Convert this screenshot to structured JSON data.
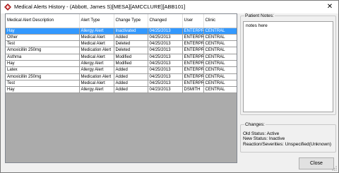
{
  "window": {
    "title": "Medical Alerts History - (Abbott, James S)[MESA][AMCCLURE][ABB101]",
    "accent_color": "#3399ff"
  },
  "grid": {
    "columns": [
      "Medical Alert Description",
      "Alert Type",
      "Change Type",
      "Changed",
      "User",
      "Clinic"
    ],
    "rows": [
      {
        "description": "Hay",
        "alert_type": "Allergy Alert",
        "change_type": "Inactivated",
        "changed": "04/25/2013",
        "user": "ENTERPRI",
        "clinic": "CENTRAL",
        "selected": true
      },
      {
        "description": "Other",
        "alert_type": "Medical Alert",
        "change_type": "Added",
        "changed": "04/25/2013",
        "user": "ENTERPRI",
        "clinic": "CENTRAL",
        "selected": false
      },
      {
        "description": "Test",
        "alert_type": "Medical Alert",
        "change_type": "Deleted",
        "changed": "04/25/2013",
        "user": "ENTERPRI",
        "clinic": "CENTRAL",
        "selected": false
      },
      {
        "description": "Amoxicillin 250mg",
        "alert_type": "Medication Alert",
        "change_type": "Deleted",
        "changed": "04/25/2013",
        "user": "ENTERPRI",
        "clinic": "CENTRAL",
        "selected": false
      },
      {
        "description": "Asthma",
        "alert_type": "Medical Alert",
        "change_type": "Modified",
        "changed": "04/25/2013",
        "user": "ENTERPRI",
        "clinic": "CENTRAL",
        "selected": false
      },
      {
        "description": "Hay",
        "alert_type": "Allergy Alert",
        "change_type": "Modified",
        "changed": "04/25/2013",
        "user": "ENTERPRI",
        "clinic": "CENTRAL",
        "selected": false
      },
      {
        "description": "Latex",
        "alert_type": "Allergy Alert",
        "change_type": "Added",
        "changed": "04/25/2013",
        "user": "ENTERPRI",
        "clinic": "CENTRAL",
        "selected": false
      },
      {
        "description": "Amoxicillin 250mg",
        "alert_type": "Medication Alert",
        "change_type": "Added",
        "changed": "04/25/2013",
        "user": "ENTERPRI",
        "clinic": "CENTRAL",
        "selected": false
      },
      {
        "description": "Test",
        "alert_type": "Medical Alert",
        "change_type": "Added",
        "changed": "04/25/2013",
        "user": "ENTERPRI",
        "clinic": "CENTRAL",
        "selected": false
      },
      {
        "description": "Hay",
        "alert_type": "Allergy Alert",
        "change_type": "Added",
        "changed": "04/23/2013",
        "user": "DSMITH",
        "clinic": "CENTRAL",
        "selected": false
      }
    ]
  },
  "patient_notes": {
    "label": "Patient Notes:",
    "value": "notes here"
  },
  "changes": {
    "label": "Changes:",
    "lines": [
      "Old Status: Active",
      "New Status: Inactive",
      "Reaction/Severities: Unspecified(Unknown)"
    ]
  },
  "buttons": {
    "close_label": "Close"
  },
  "icons": {
    "app": "medical-alert-icon",
    "window_close": "close-icon",
    "resize": "resize-grip-icon"
  }
}
